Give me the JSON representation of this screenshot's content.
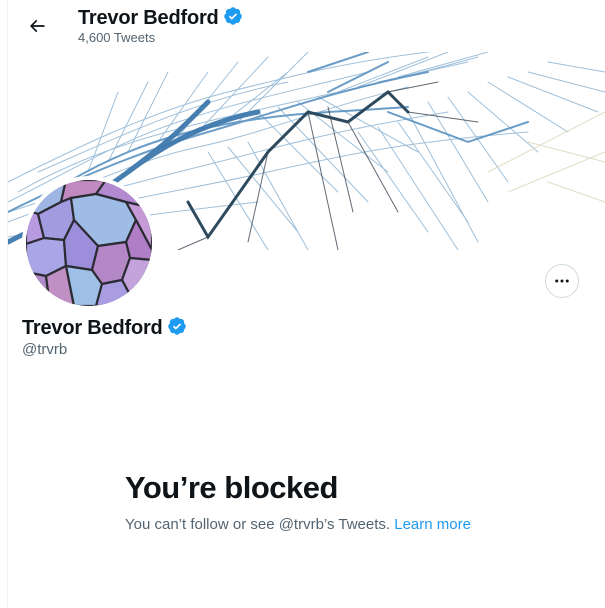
{
  "header": {
    "back_icon": "arrow-left-icon",
    "name": "Trevor Bedford",
    "verified_icon": "verified-badge-icon",
    "tweet_count": "4,600 Tweets"
  },
  "banner": {
    "description_icon": "phylogenetic-tree-banner"
  },
  "profile": {
    "name": "Trevor Bedford",
    "handle": "@trvrb",
    "more_icon": "more-horizontal-icon"
  },
  "blocked": {
    "title": "You’re blocked",
    "message": "You can’t follow or see @trvrb’s Tweets.",
    "learn_more": "Learn more"
  },
  "colors": {
    "accent": "#1d9bf0",
    "text": "#0f1419",
    "muted": "#536471",
    "banner_blue": "#4a86b8"
  }
}
